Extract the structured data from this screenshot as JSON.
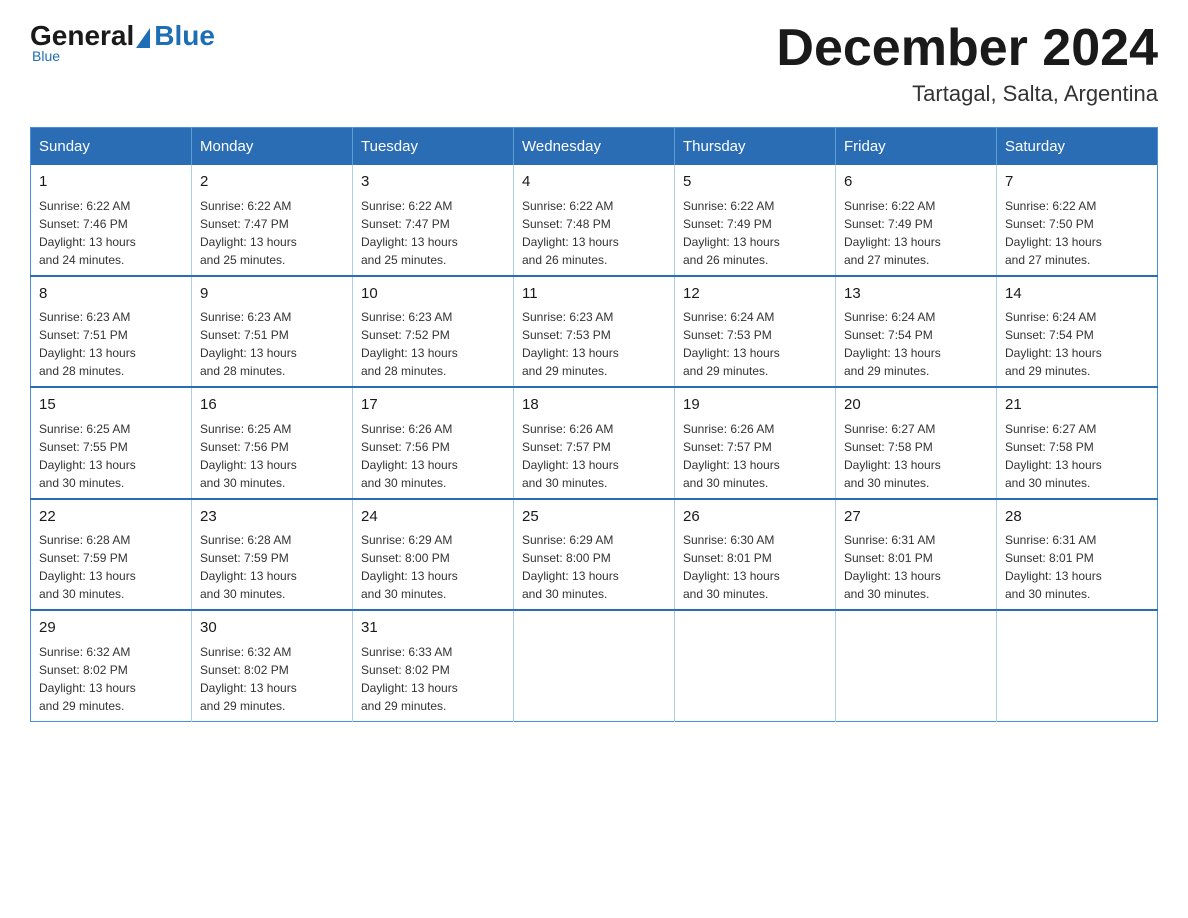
{
  "logo": {
    "general": "General",
    "blue": "Blue"
  },
  "header": {
    "month": "December 2024",
    "location": "Tartagal, Salta, Argentina"
  },
  "weekdays": [
    "Sunday",
    "Monday",
    "Tuesday",
    "Wednesday",
    "Thursday",
    "Friday",
    "Saturday"
  ],
  "weeks": [
    [
      {
        "day": "1",
        "sunrise": "6:22 AM",
        "sunset": "7:46 PM",
        "daylight": "13 hours and 24 minutes."
      },
      {
        "day": "2",
        "sunrise": "6:22 AM",
        "sunset": "7:47 PM",
        "daylight": "13 hours and 25 minutes."
      },
      {
        "day": "3",
        "sunrise": "6:22 AM",
        "sunset": "7:47 PM",
        "daylight": "13 hours and 25 minutes."
      },
      {
        "day": "4",
        "sunrise": "6:22 AM",
        "sunset": "7:48 PM",
        "daylight": "13 hours and 26 minutes."
      },
      {
        "day": "5",
        "sunrise": "6:22 AM",
        "sunset": "7:49 PM",
        "daylight": "13 hours and 26 minutes."
      },
      {
        "day": "6",
        "sunrise": "6:22 AM",
        "sunset": "7:49 PM",
        "daylight": "13 hours and 27 minutes."
      },
      {
        "day": "7",
        "sunrise": "6:22 AM",
        "sunset": "7:50 PM",
        "daylight": "13 hours and 27 minutes."
      }
    ],
    [
      {
        "day": "8",
        "sunrise": "6:23 AM",
        "sunset": "7:51 PM",
        "daylight": "13 hours and 28 minutes."
      },
      {
        "day": "9",
        "sunrise": "6:23 AM",
        "sunset": "7:51 PM",
        "daylight": "13 hours and 28 minutes."
      },
      {
        "day": "10",
        "sunrise": "6:23 AM",
        "sunset": "7:52 PM",
        "daylight": "13 hours and 28 minutes."
      },
      {
        "day": "11",
        "sunrise": "6:23 AM",
        "sunset": "7:53 PM",
        "daylight": "13 hours and 29 minutes."
      },
      {
        "day": "12",
        "sunrise": "6:24 AM",
        "sunset": "7:53 PM",
        "daylight": "13 hours and 29 minutes."
      },
      {
        "day": "13",
        "sunrise": "6:24 AM",
        "sunset": "7:54 PM",
        "daylight": "13 hours and 29 minutes."
      },
      {
        "day": "14",
        "sunrise": "6:24 AM",
        "sunset": "7:54 PM",
        "daylight": "13 hours and 29 minutes."
      }
    ],
    [
      {
        "day": "15",
        "sunrise": "6:25 AM",
        "sunset": "7:55 PM",
        "daylight": "13 hours and 30 minutes."
      },
      {
        "day": "16",
        "sunrise": "6:25 AM",
        "sunset": "7:56 PM",
        "daylight": "13 hours and 30 minutes."
      },
      {
        "day": "17",
        "sunrise": "6:26 AM",
        "sunset": "7:56 PM",
        "daylight": "13 hours and 30 minutes."
      },
      {
        "day": "18",
        "sunrise": "6:26 AM",
        "sunset": "7:57 PM",
        "daylight": "13 hours and 30 minutes."
      },
      {
        "day": "19",
        "sunrise": "6:26 AM",
        "sunset": "7:57 PM",
        "daylight": "13 hours and 30 minutes."
      },
      {
        "day": "20",
        "sunrise": "6:27 AM",
        "sunset": "7:58 PM",
        "daylight": "13 hours and 30 minutes."
      },
      {
        "day": "21",
        "sunrise": "6:27 AM",
        "sunset": "7:58 PM",
        "daylight": "13 hours and 30 minutes."
      }
    ],
    [
      {
        "day": "22",
        "sunrise": "6:28 AM",
        "sunset": "7:59 PM",
        "daylight": "13 hours and 30 minutes."
      },
      {
        "day": "23",
        "sunrise": "6:28 AM",
        "sunset": "7:59 PM",
        "daylight": "13 hours and 30 minutes."
      },
      {
        "day": "24",
        "sunrise": "6:29 AM",
        "sunset": "8:00 PM",
        "daylight": "13 hours and 30 minutes."
      },
      {
        "day": "25",
        "sunrise": "6:29 AM",
        "sunset": "8:00 PM",
        "daylight": "13 hours and 30 minutes."
      },
      {
        "day": "26",
        "sunrise": "6:30 AM",
        "sunset": "8:01 PM",
        "daylight": "13 hours and 30 minutes."
      },
      {
        "day": "27",
        "sunrise": "6:31 AM",
        "sunset": "8:01 PM",
        "daylight": "13 hours and 30 minutes."
      },
      {
        "day": "28",
        "sunrise": "6:31 AM",
        "sunset": "8:01 PM",
        "daylight": "13 hours and 30 minutes."
      }
    ],
    [
      {
        "day": "29",
        "sunrise": "6:32 AM",
        "sunset": "8:02 PM",
        "daylight": "13 hours and 29 minutes."
      },
      {
        "day": "30",
        "sunrise": "6:32 AM",
        "sunset": "8:02 PM",
        "daylight": "13 hours and 29 minutes."
      },
      {
        "day": "31",
        "sunrise": "6:33 AM",
        "sunset": "8:02 PM",
        "daylight": "13 hours and 29 minutes."
      },
      null,
      null,
      null,
      null
    ]
  ],
  "labels": {
    "sunrise": "Sunrise:",
    "sunset": "Sunset:",
    "daylight": "Daylight:"
  }
}
